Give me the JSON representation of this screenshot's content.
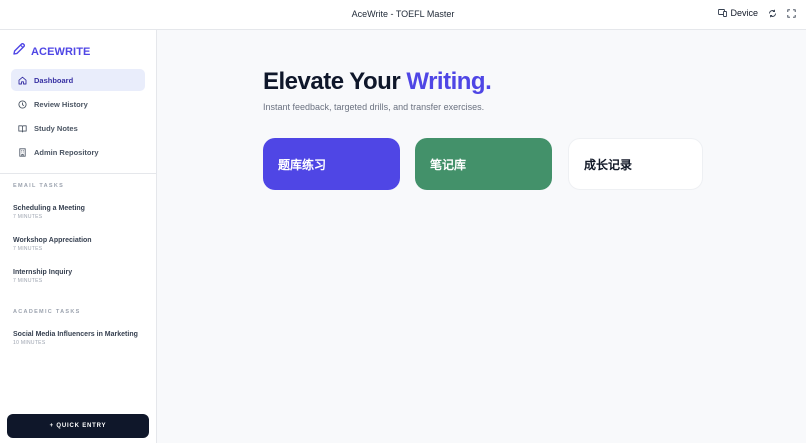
{
  "window": {
    "title": "AceWrite - TOEFL Master",
    "device_label": "Device"
  },
  "sidebar": {
    "brand": "ACEWRITE",
    "nav": [
      {
        "label": "Dashboard",
        "icon": "home-icon",
        "active": true
      },
      {
        "label": "Review History",
        "icon": "clock-icon",
        "active": false
      },
      {
        "label": "Study Notes",
        "icon": "book-icon",
        "active": false
      },
      {
        "label": "Admin Repository",
        "icon": "building-icon",
        "active": false
      }
    ],
    "email_section": "EMAIL TASKS",
    "email_tasks": [
      {
        "title": "Scheduling a Meeting",
        "meta": "7 MINUTES"
      },
      {
        "title": "Workshop Appreciation",
        "meta": "7 MINUTES"
      },
      {
        "title": "Internship Inquiry",
        "meta": "7 MINUTES"
      }
    ],
    "academic_section": "ACADEMIC TASKS",
    "academic_tasks": [
      {
        "title": "Social Media Influencers in Marketing",
        "meta": "10 MINUTES"
      }
    ],
    "quick_entry": "+ QUICK ENTRY"
  },
  "main": {
    "headline_prefix": "Elevate Your",
    "headline_accent": "Writing.",
    "subtitle": "Instant feedback, targeted drills, and transfer exercises.",
    "cards": [
      {
        "label": "题库练习"
      },
      {
        "label": "笔记库"
      },
      {
        "label": "成长记录"
      }
    ]
  },
  "colors": {
    "accent": "#4f46e5",
    "green": "#43916a",
    "dark": "#0f172a"
  }
}
